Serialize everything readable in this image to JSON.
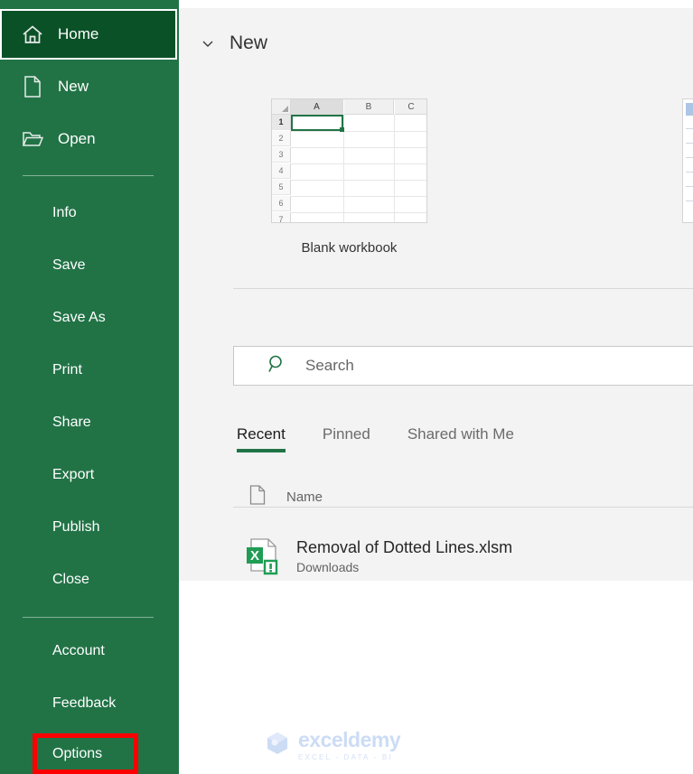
{
  "sidebar": {
    "background_color": "#217346",
    "highlight_color": "#0b5128",
    "items": [
      {
        "label": "Home",
        "icon": "home-icon",
        "selected": true
      },
      {
        "label": "New",
        "icon": "page-icon",
        "selected": false
      },
      {
        "label": "Open",
        "icon": "folder-icon",
        "selected": false
      },
      {
        "label": "Info",
        "icon": "",
        "selected": false
      },
      {
        "label": "Save",
        "icon": "",
        "selected": false
      },
      {
        "label": "Save As",
        "icon": "",
        "selected": false
      },
      {
        "label": "Print",
        "icon": "",
        "selected": false
      },
      {
        "label": "Share",
        "icon": "",
        "selected": false
      },
      {
        "label": "Export",
        "icon": "",
        "selected": false
      },
      {
        "label": "Publish",
        "icon": "",
        "selected": false
      },
      {
        "label": "Close",
        "icon": "",
        "selected": false
      },
      {
        "label": "Account",
        "icon": "",
        "selected": false
      },
      {
        "label": "Feedback",
        "icon": "",
        "selected": false
      },
      {
        "label": "Options",
        "icon": "",
        "selected": false
      }
    ]
  },
  "annotation": {
    "target_label": "Options",
    "color": "#ff0000"
  },
  "main": {
    "new_section": {
      "title": "New",
      "collapse_icon": "chevron-down-icon",
      "templates": [
        {
          "label": "Blank workbook"
        }
      ],
      "thumbnail": {
        "columns": [
          "A",
          "B",
          "C"
        ],
        "rows": [
          "1",
          "2",
          "3",
          "4",
          "5",
          "6",
          "7"
        ],
        "selected_cell": "A1",
        "selection_color": "#217346"
      }
    },
    "search": {
      "placeholder": "Search",
      "icon": "search-icon",
      "value": ""
    },
    "tabs": [
      {
        "label": "Recent",
        "active": true
      },
      {
        "label": "Pinned",
        "active": false
      },
      {
        "label": "Shared with Me",
        "active": false
      }
    ],
    "list_header": {
      "name_column": "Name",
      "icon": "page-icon"
    },
    "files": [
      {
        "name": "Removal of Dotted Lines.xlsm",
        "location": "Downloads",
        "icon": "excel-macro-file-icon"
      }
    ]
  },
  "watermark": {
    "name": "exceldemy",
    "tagline": "EXCEL - DATA - BI"
  }
}
